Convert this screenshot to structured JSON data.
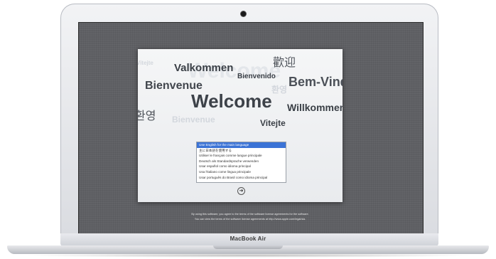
{
  "device": {
    "brand": "MacBook Air"
  },
  "welcome": {
    "words": {
      "vitejte_ghost": "Vitejte",
      "valkommen": "Valkommen",
      "welcome_ghost": "Welcome",
      "huanying": "歡迎",
      "bienvenido": "Bienvenido",
      "bem_vindo": "Bem-Vindo",
      "bienvenue": "Bienvenue",
      "korean_ghost": "환영",
      "welcome": "Welcome",
      "willkommen": "Willkommen",
      "korean": "환영",
      "bienvenue_ghost": "Bienvenue",
      "vitejte": "Vitejte"
    },
    "languages": [
      "Use English for the main language",
      "主に日本語を使用する",
      "Utiliser le français comme langue principale",
      "Deutsch als Standardsprache verwenden",
      "Usar español como idioma principal",
      "Usa l'italiano come lingua principale",
      "Usar português do Brasil como idioma principal"
    ],
    "selected_index": 0,
    "continue_icon": "arrow-circle-icon",
    "continue_glyph": "➜"
  },
  "license": {
    "line1": "By using this software, you agree to the terms of the software license agreements for the software.",
    "line2": "You can view the terms of the software license agreements at http://www.apple.com/legal/sla."
  }
}
